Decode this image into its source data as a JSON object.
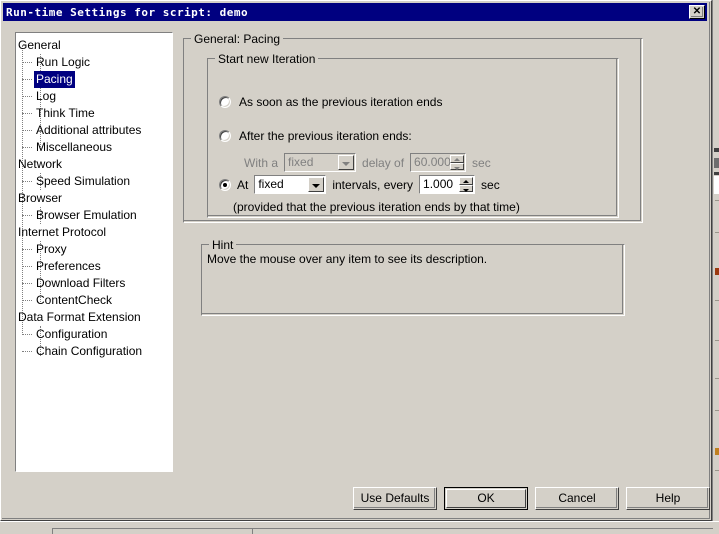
{
  "window": {
    "title": "Run-time Settings for script: demo",
    "close_label": "✕",
    "title_bar_color": "#000080",
    "face_color": "#d4d0c8"
  },
  "tree": {
    "selected": "Pacing",
    "items": [
      {
        "label": "General",
        "level": 0
      },
      {
        "label": "Run Logic",
        "level": 1
      },
      {
        "label": "Pacing",
        "level": 1
      },
      {
        "label": "Log",
        "level": 1
      },
      {
        "label": "Think Time",
        "level": 1
      },
      {
        "label": "Additional attributes",
        "level": 1
      },
      {
        "label": "Miscellaneous",
        "level": 1
      },
      {
        "label": "Network",
        "level": 0
      },
      {
        "label": "Speed Simulation",
        "level": 1
      },
      {
        "label": "Browser",
        "level": 0
      },
      {
        "label": "Browser Emulation",
        "level": 1
      },
      {
        "label": "Internet Protocol",
        "level": 0
      },
      {
        "label": "Proxy",
        "level": 1
      },
      {
        "label": "Preferences",
        "level": 1
      },
      {
        "label": "Download Filters",
        "level": 1
      },
      {
        "label": "ContentCheck",
        "level": 1
      },
      {
        "label": "Data Format Extension",
        "level": 0
      },
      {
        "label": "Configuration",
        "level": 1
      },
      {
        "label": "Chain Configuration",
        "level": 1
      }
    ]
  },
  "panel": {
    "title": "General: Pacing",
    "iteration_group": {
      "title": "Start new Iteration",
      "option_immediate": {
        "label": "As soon as the previous iteration ends",
        "selected": false
      },
      "option_after": {
        "label": "After the previous iteration ends:",
        "selected": false,
        "prefix": "With a",
        "distribution": "fixed",
        "middle": "delay of",
        "delay_value": "60.000",
        "unit": "sec",
        "enabled": false
      },
      "option_at": {
        "label": "At",
        "selected": true,
        "distribution": "fixed",
        "middle": "intervals, every",
        "interval_value": "1.000",
        "unit": "sec",
        "note": "(provided that the previous iteration ends by that time)",
        "enabled": true
      }
    },
    "hint_group": {
      "title": "Hint",
      "text": "Move the mouse over any item to see its description."
    }
  },
  "buttons": {
    "use_defaults": "Use Defaults",
    "ok": "OK",
    "cancel": "Cancel",
    "help": "Help"
  }
}
